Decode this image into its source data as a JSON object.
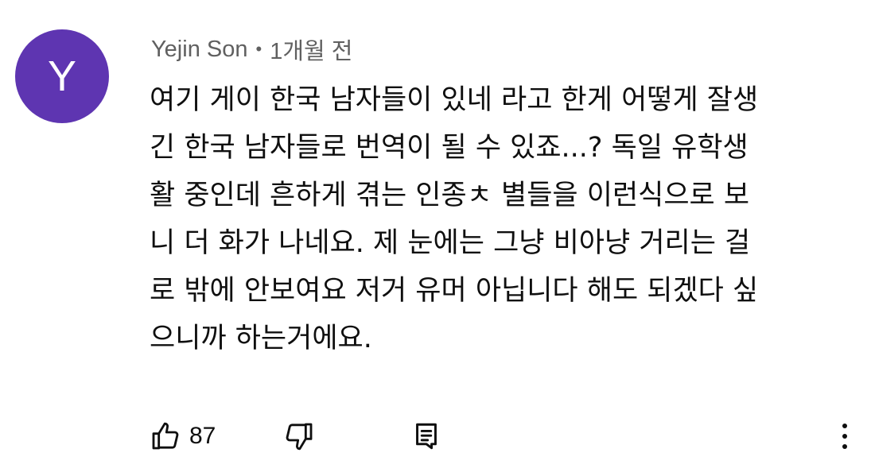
{
  "comment": {
    "avatar_letter": "Y",
    "avatar_color": "#5e35b1",
    "author": "Yejin Son",
    "separator": "•",
    "timestamp": "1개월 전",
    "body_lines": [
      "여기 게이  한국 남자들이 있네 라고 한게 어떻게 잘생",
      "긴 한국 남자들로 번역이 될 수 있죠...? 독일 유학생",
      "활 중인데 흔하게 겪는 인종ㅊ 별들을 이런식으로 보",
      "니 더 화가 나네요. 제 눈에는 그냥 비아냥 거리는 걸",
      "로 밖에 안보여요 저거 유머 아닙니다 해도 되겠다 싶",
      "으니까 하는거에요."
    ],
    "like_count": "87",
    "icons": {
      "like": "thumbs-up-icon",
      "dislike": "thumbs-down-icon",
      "reply": "reply-icon",
      "more": "more-vert-icon"
    }
  }
}
